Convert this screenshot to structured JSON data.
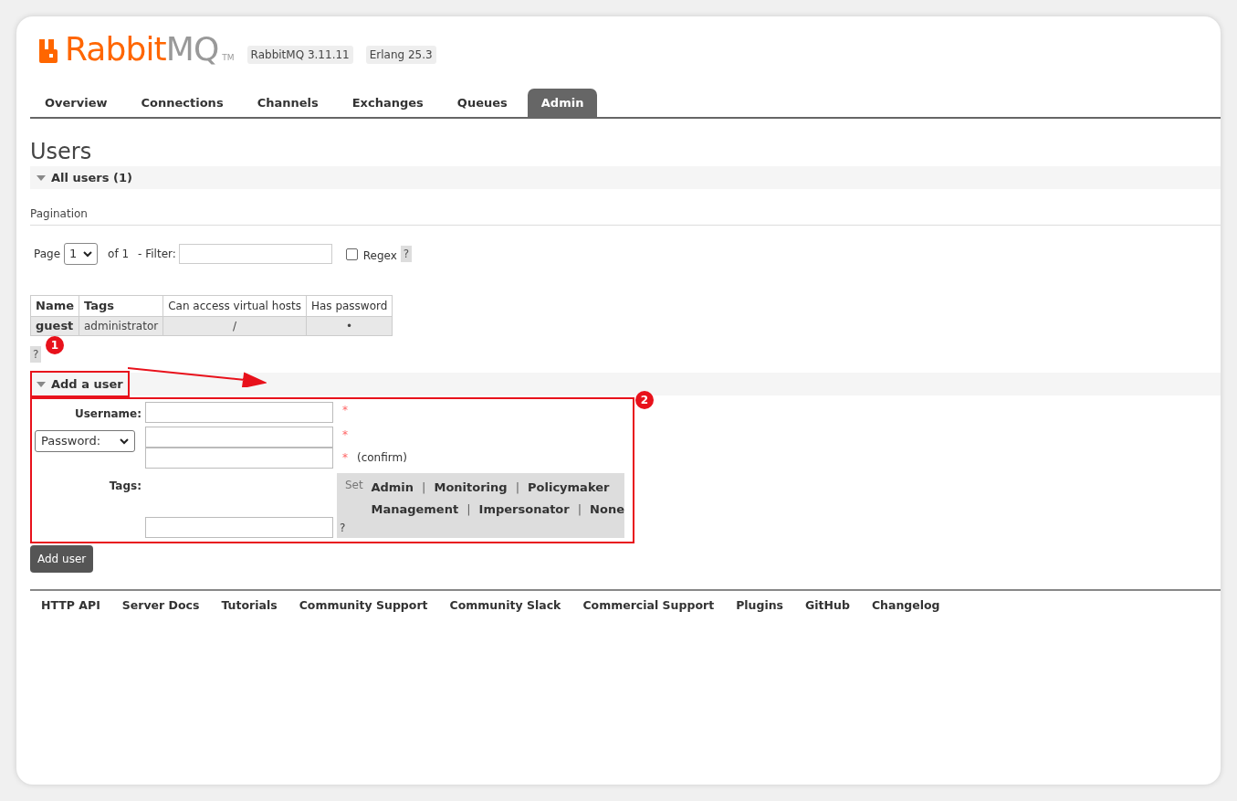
{
  "header": {
    "logo_main": "Rabbit",
    "logo_suffix": "MQ",
    "logo_tm": "TM",
    "badges": [
      "RabbitMQ 3.11.11",
      "Erlang 25.3"
    ]
  },
  "tabs": [
    {
      "label": "Overview",
      "selected": false
    },
    {
      "label": "Connections",
      "selected": false
    },
    {
      "label": "Channels",
      "selected": false
    },
    {
      "label": "Exchanges",
      "selected": false
    },
    {
      "label": "Queues",
      "selected": false
    },
    {
      "label": "Admin",
      "selected": true
    }
  ],
  "page_title": "Users",
  "all_users": {
    "title": "All users (1)",
    "expanded": true,
    "pagination_label": "Pagination",
    "page_label": "Page",
    "page_value": "1",
    "of_label": "of 1",
    "filter_label": "- Filter:",
    "regex_label": "Regex",
    "regex_checked": false,
    "help": "?",
    "table": {
      "columns": [
        "Name",
        "Tags",
        "Can access virtual hosts",
        "Has password"
      ],
      "rows": [
        [
          "guest",
          "administrator",
          "/",
          "•"
        ]
      ]
    },
    "table_help": "?"
  },
  "add_user": {
    "title": "Add a user",
    "expanded": true,
    "username_label": "Username:",
    "required_mark": "*",
    "password_select": "Password:",
    "confirm_label": "(confirm)",
    "tags_label": "Tags:",
    "set_label": "Set",
    "tag_rows": [
      [
        {
          "kind": "link",
          "text": "Admin"
        },
        {
          "kind": "separator",
          "text": "|"
        },
        {
          "kind": "link",
          "text": "Monitoring"
        },
        {
          "kind": "separator",
          "text": "|"
        },
        {
          "kind": "link",
          "text": "Policymaker"
        }
      ],
      [
        {
          "kind": "link",
          "text": "Management"
        },
        {
          "kind": "separator",
          "text": "|"
        },
        {
          "kind": "link",
          "text": "Impersonator"
        },
        {
          "kind": "separator",
          "text": "|"
        },
        {
          "kind": "link",
          "text": "None"
        }
      ]
    ],
    "tags_help": "?",
    "submit": "Add user"
  },
  "footer_links": [
    "HTTP API",
    "Server Docs",
    "Tutorials",
    "Community Support",
    "Community Slack",
    "Commercial Support",
    "Plugins",
    "GitHub",
    "Changelog"
  ],
  "annotations": [
    "1",
    "2"
  ]
}
